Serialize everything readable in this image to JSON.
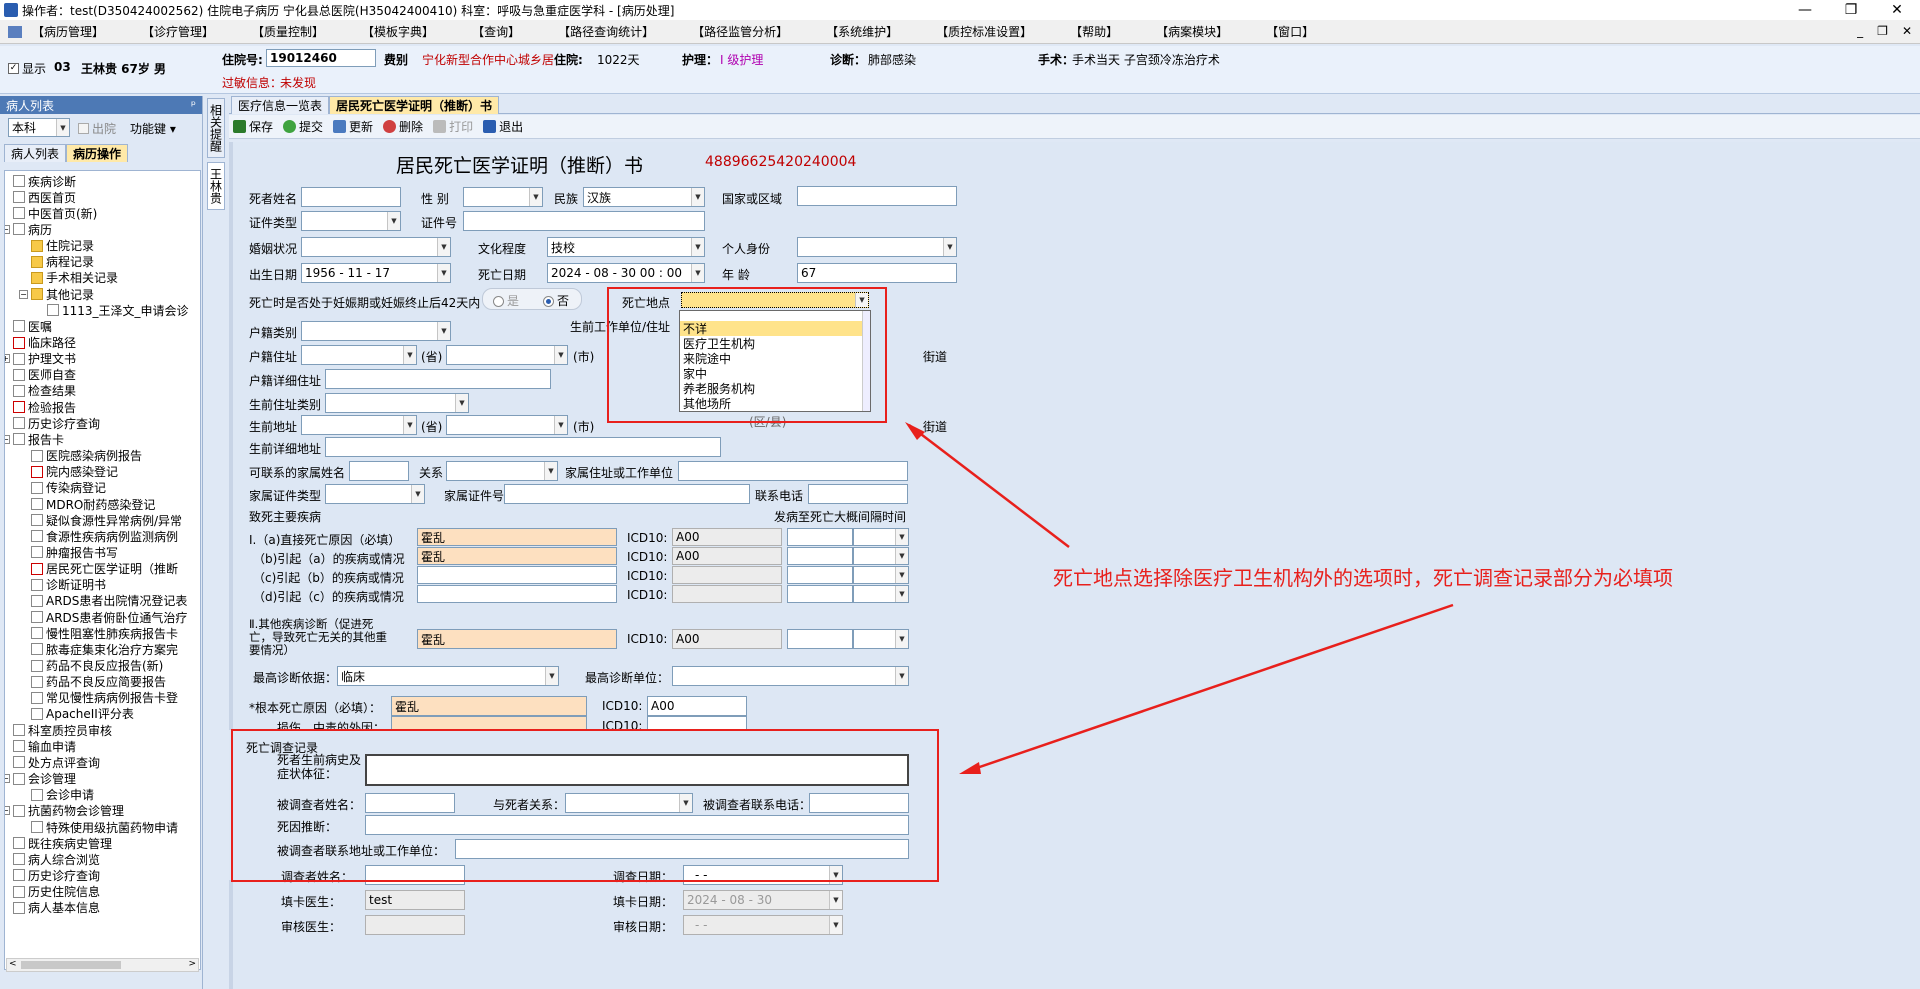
{
  "window": {
    "title": "操作者：test(D350424002562) 住院电子病历  宁化县总医院(H35042400410)  科室：呼吸与急重症医学科 - [病历处理]"
  },
  "menu": [
    "【病历管理】",
    "【诊疗管理】",
    "【质量控制】",
    "【模板字典】",
    "【查询】",
    "【路径查询统计】",
    "【路径监管分析】",
    "【系统维护】",
    "【质控标准设置】",
    "【帮助】",
    "【病案模块】",
    "【窗口】"
  ],
  "patient": {
    "show_label": "显示",
    "bed": "03",
    "name_info": "王林贵 67岁 男",
    "admission_no_label": "住院号:",
    "admission_no": "19012460",
    "fee_type_label": "费别",
    "fee_type": "宁化新型合作中心城乡居",
    "days_label": "住院:",
    "days": "1022天",
    "nursing_label": "护理：",
    "nursing": "I 级护理",
    "diagnosis_label": "诊断：",
    "diagnosis": "肺部感染",
    "surgery_label": "手术：",
    "surgery": "手术当天  子宫颈冷冻治疗术",
    "allergy_label": "过敏信息：",
    "allergy": "未发现"
  },
  "left": {
    "header": "病人列表",
    "pin": "ᵖ",
    "dept": "本科",
    "discharged": "出院",
    "func_key": "功能键",
    "tabs": [
      "病人列表",
      "病历操作"
    ],
    "tree": [
      {
        "label": "疾病诊断",
        "level": 1,
        "icon": "doc"
      },
      {
        "label": "西医首页",
        "level": 1,
        "icon": "doc"
      },
      {
        "label": "中医首页(新)",
        "level": 1,
        "icon": "doc"
      },
      {
        "label": "病历",
        "level": 1,
        "icon": "doc",
        "expander": "−"
      },
      {
        "label": "住院记录",
        "level": 2,
        "icon": "folder"
      },
      {
        "label": "病程记录",
        "level": 2,
        "icon": "folder"
      },
      {
        "label": "手术相关记录",
        "level": 2,
        "icon": "folder"
      },
      {
        "label": "其他记录",
        "level": 2,
        "icon": "folder",
        "expander": "−"
      },
      {
        "label": "1113_王泽文_申请会诊",
        "level": 3,
        "icon": "doc"
      },
      {
        "label": "医嘱",
        "level": 1,
        "icon": "doc"
      },
      {
        "label": "临床路径",
        "level": 1,
        "icon": "red"
      },
      {
        "label": "护理文书",
        "level": 1,
        "icon": "doc",
        "expander": "+"
      },
      {
        "label": "医师自查",
        "level": 1,
        "icon": "doc"
      },
      {
        "label": "检查结果",
        "level": 1,
        "icon": "doc"
      },
      {
        "label": "检验报告",
        "level": 1,
        "icon": "red"
      },
      {
        "label": "历史诊疗查询",
        "level": 1,
        "icon": "doc"
      },
      {
        "label": "报告卡",
        "level": 1,
        "icon": "doc",
        "expander": "−"
      },
      {
        "label": "医院感染病例报告",
        "level": 2,
        "icon": "doc"
      },
      {
        "label": "院内感染登记",
        "level": 2,
        "icon": "red"
      },
      {
        "label": "传染病登记",
        "level": 2,
        "icon": "doc"
      },
      {
        "label": "MDRO耐药感染登记",
        "level": 2,
        "icon": "doc"
      },
      {
        "label": "疑似食源性异常病例/异常",
        "level": 2,
        "icon": "doc"
      },
      {
        "label": "食源性疾病病例监测病例",
        "level": 2,
        "icon": "doc"
      },
      {
        "label": "肿瘤报告书写",
        "level": 2,
        "icon": "doc"
      },
      {
        "label": "居民死亡医学证明（推断",
        "level": 2,
        "icon": "red"
      },
      {
        "label": "诊断证明书",
        "level": 2,
        "icon": "doc"
      },
      {
        "label": "ARDS患者出院情况登记表",
        "level": 2,
        "icon": "doc"
      },
      {
        "label": "ARDS患者俯卧位通气治疗",
        "level": 2,
        "icon": "doc"
      },
      {
        "label": "慢性阻塞性肺疾病报告卡",
        "level": 2,
        "icon": "doc"
      },
      {
        "label": "脓毒症集束化治疗方案完",
        "level": 2,
        "icon": "doc"
      },
      {
        "label": "药品不良反应报告(新)",
        "level": 2,
        "icon": "doc"
      },
      {
        "label": "药品不良反应简要报告",
        "level": 2,
        "icon": "doc"
      },
      {
        "label": "常见慢性病病例报告卡登",
        "level": 2,
        "icon": "doc"
      },
      {
        "label": "ApacheII评分表",
        "level": 2,
        "icon": "doc"
      },
      {
        "label": "科室质控员审核",
        "level": 1,
        "icon": "doc"
      },
      {
        "label": "输血申请",
        "level": 1,
        "icon": "doc"
      },
      {
        "label": "处方点评查询",
        "level": 1,
        "icon": "doc"
      },
      {
        "label": "会诊管理",
        "level": 1,
        "icon": "doc",
        "expander": "−"
      },
      {
        "label": "会诊申请",
        "level": 2,
        "icon": "doc"
      },
      {
        "label": "抗菌药物会诊管理",
        "level": 1,
        "icon": "doc",
        "expander": "−"
      },
      {
        "label": "特殊使用级抗菌药物申请",
        "level": 2,
        "icon": "doc"
      },
      {
        "label": "既往疾病史管理",
        "level": 1,
        "icon": "doc"
      },
      {
        "label": "病人综合浏览",
        "level": 1,
        "icon": "doc"
      },
      {
        "label": "历史诊疗查询",
        "level": 1,
        "icon": "doc"
      },
      {
        "label": "历史住院信息",
        "level": 1,
        "icon": "doc"
      },
      {
        "label": "病人基本信息",
        "level": 1,
        "icon": "doc"
      }
    ]
  },
  "vtabs": [
    "相关提醒",
    "王林贵"
  ],
  "main_tabs": [
    "医疗信息一览表",
    "居民死亡医学证明（推断）书"
  ],
  "toolbar": [
    "保存",
    "提交",
    "更新",
    "删除",
    "打印",
    "退出"
  ],
  "form": {
    "title": "居民死亡医学证明（推断）书",
    "cert_no": "48896625420240004",
    "deceased_name": "死者姓名",
    "gender": "性  别",
    "ethnicity": "民族",
    "ethnicity_val": "汉族",
    "country": "国家或区域",
    "id_type": "证件类型",
    "id_no": "证件号",
    "marital": "婚姻状况",
    "education": "文化程度",
    "education_val": "技校",
    "identity": "个人身份",
    "birth_date": "出生日期",
    "birth_date_val": "1956 - 11 - 17",
    "death_date": "死亡日期",
    "death_date_val": "2024 - 08 - 30    00 : 00",
    "age": "年  龄",
    "age_val": "67",
    "pregnancy_q": "死亡时是否处于妊娠期或妊娠终止后42天内",
    "yes": "是",
    "no": "否",
    "death_place": "死亡地点",
    "death_place_options": [
      "不详",
      "医疗卫生机构",
      "来院途中",
      "家中",
      "养老服务机构",
      "其他场所"
    ],
    "hukou_type": "户籍类别",
    "work_unit": "生前工作单位/住址",
    "hukou_addr": "户籍住址",
    "province": "(省)",
    "city": "(市)",
    "street": "街道",
    "hukou_detail": "户籍详细住址",
    "live_addr_type": "生前住址类别",
    "live_addr": "生前地址",
    "district_frag": "(区/县)",
    "live_detail": "生前详细地址",
    "family_name": "可联系的家属姓名",
    "relation": "关系",
    "family_addr": "家属住址或工作单位",
    "family_id_type": "家属证件类型",
    "family_id_no": "家属证件号",
    "phone": "联系电话",
    "main_disease": "致死主要疾病",
    "interval": "发病至死亡大概间隔时间",
    "causes": [
      {
        "label": "I.（a)直接死亡原因（必填）",
        "value": "霍乱",
        "icd": "A00",
        "peach": true
      },
      {
        "label": "（b)引起（a）的疾病或情况",
        "value": "霍乱",
        "icd": "A00",
        "peach": true
      },
      {
        "label": "（c)引起（b）的疾病或情况",
        "value": "",
        "icd": "",
        "peach": false
      },
      {
        "label": "（d)引起（c）的疾病或情况",
        "value": "",
        "icd": "",
        "peach": false
      }
    ],
    "other_cause_label": "Ⅱ.其他疾病诊断（促进死亡，导致死亡无关的其他重要情况）",
    "other_cause_val": "霍乱",
    "other_icd": "A00",
    "icd_label": "ICD10:",
    "highest_basis": "最高诊断依据：",
    "highest_basis_val": "临床",
    "highest_unit": "最高诊断单位：",
    "root_cause": "*根本死亡原因（必填）：",
    "root_cause_val": "霍乱",
    "root_icd": "A00",
    "injury": "损伤、中毒的外因：",
    "investigation_title": "死亡调查记录",
    "history": "死者生前病史及症状体征：",
    "respondent": "被调查者姓名：",
    "resp_relation": "与死者关系：",
    "resp_phone": "被调查者联系电话：",
    "cause_infer": "死因推断：",
    "resp_addr": "被调查者联系地址或工作单位：",
    "investigator": "调查者姓名：",
    "inv_date": "调查日期：",
    "inv_date_val": "-   -",
    "card_doctor": "填卡医生：",
    "card_doctor_val": "test",
    "card_date": "填卡日期：",
    "card_date_val": "2024 - 08 - 30",
    "review_doctor": "审核医生：",
    "review_date": "审核日期：",
    "review_date_val": "-   -"
  },
  "annotation": "死亡地点选择除医疗卫生机构外的选项时，死亡调查记录部分为必填项",
  "colors": {
    "annotation": "#e8201c",
    "highlight": "#ffe38a",
    "required": "#fde0c0"
  }
}
